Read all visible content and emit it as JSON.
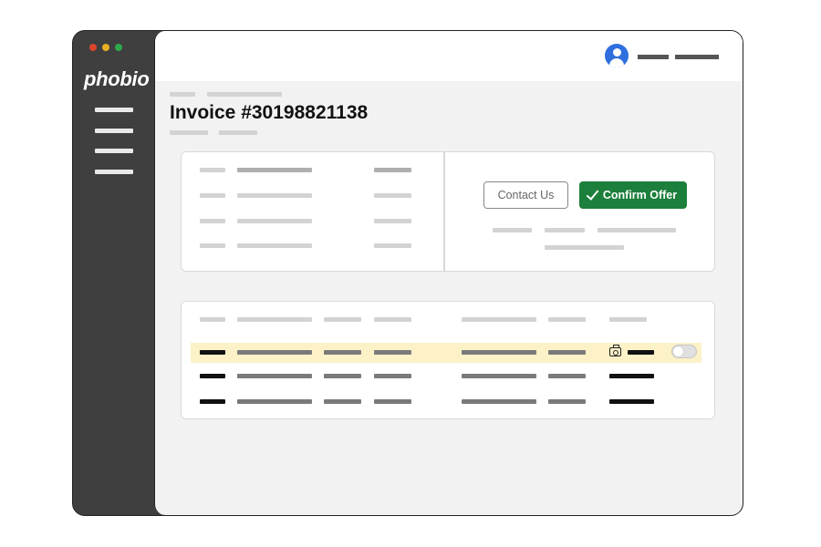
{
  "app": {
    "logo": "phobio",
    "window_controls": {
      "close_color": "#d9452b",
      "minimize_color": "#e8b023",
      "maximize_color": "#2ea84b"
    }
  },
  "sidebar": {
    "items": [
      "nav-1",
      "nav-2",
      "nav-3",
      "nav-4"
    ]
  },
  "page": {
    "title": "Invoice #30198821138"
  },
  "actions": {
    "contact_label": "Contact Us",
    "confirm_label": "Confirm Offer"
  },
  "colors": {
    "accent": "#1c7f3b",
    "avatar": "#2f6fde",
    "highlight": "#fdf1c7",
    "sidebar": "#3f3f3f"
  },
  "icons": {
    "confirm": "check-icon",
    "user": "user-avatar-icon",
    "row_attachment": "camera-icon"
  },
  "table": {
    "highlighted_row": 1,
    "toggle_on": false
  }
}
